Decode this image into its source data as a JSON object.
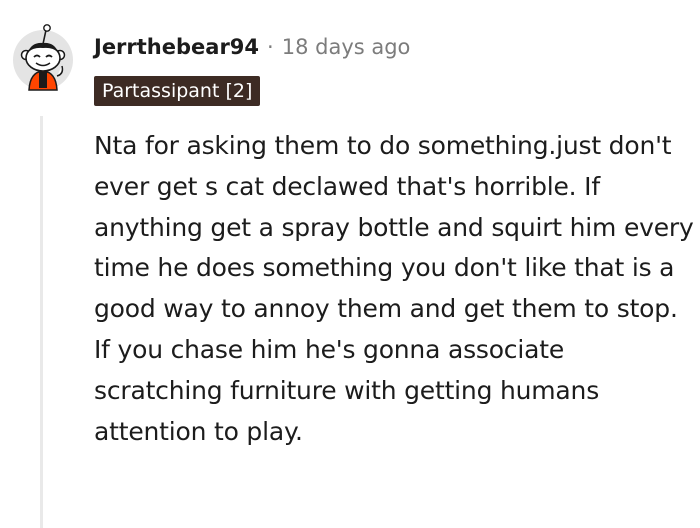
{
  "comment": {
    "author": "Jerrthebear94",
    "separator": "·",
    "timestamp": "18 days ago",
    "flair": "Partassipant [2]",
    "body": "Nta for asking them to do something.just don't ever get s cat declawed that's horrible. If anything get a spray bottle and squirt him every time he does something you don't like that is a good way to annoy them and get them to stop. If you chase him he's gonna associate scratching furniture with getting humans attention to play."
  },
  "avatar": {
    "icon": "reddit-snoo-avatar-icon",
    "colors": {
      "background": "#e4e4e4",
      "shirt": "#ff4500",
      "skin": "#ffffff",
      "outline": "#1a1a1a"
    }
  },
  "colors": {
    "flair_background": "#3d2b24",
    "flair_text": "#ffffff",
    "meta_text": "#7c7c7c",
    "thread_line": "#e9e9e9"
  }
}
